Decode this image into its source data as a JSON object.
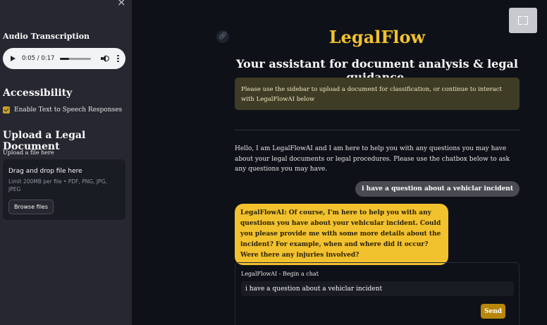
{
  "sidebar": {
    "close_glyph": "×",
    "audio_heading": "Audio Transcription",
    "audio": {
      "current_time": "0:05",
      "duration": "0:17",
      "time_display": "0:05 / 0:17",
      "progress_fraction": 0.29
    },
    "accessibility_heading": "Accessibility",
    "tts_label": "Enable Text to Speech Responses",
    "tts_checked": true,
    "upload_heading": "Upload a Legal Document",
    "uploader_label": "Upload a file here",
    "dropzone_title": "Drag and drop file here",
    "dropzone_limit": "Limit 200MB per file • PDF, PNG, JPG, JPEG",
    "browse_label": "Browse files"
  },
  "main": {
    "title": "LegalFlow",
    "subtitle": "Your assistant for document analysis & legal guidance.",
    "info_message": "Please use the sidebar to upload a document for classification, or continue to interact with LegalFlowAI below",
    "intro": "Hello, I am LegalFlowAI and I am here to help you with any questions you may have about your legal documents or legal procedures. Please use the chatbox below to ask any questions you may have.",
    "messages": [
      {
        "role": "user",
        "text": "i have a question about a vehiclar incident"
      },
      {
        "role": "assistant",
        "text": "LegalFlowAI: Of course, I'm here to help you with any questions you have about your vehicular incident. Could you please provide me with some more details about the incident? For example, when and where did it occur? Were there any injuries involved?"
      }
    ],
    "chat": {
      "label": "LegalFlowAI - Begin a chat",
      "input_value": "i have a question about a vehiclar incident",
      "send_label": "Send"
    }
  },
  "colors": {
    "accent": "#f2c12e",
    "send_button": "#b8860b",
    "sidebar_bg": "#262730",
    "main_bg": "#0e1117",
    "info_bg": "#3e3c25"
  },
  "icons": [
    "close-icon",
    "play-icon",
    "volume-icon",
    "more-vert-icon",
    "link-icon",
    "fullscreen-icon",
    "checkbox-icon"
  ]
}
